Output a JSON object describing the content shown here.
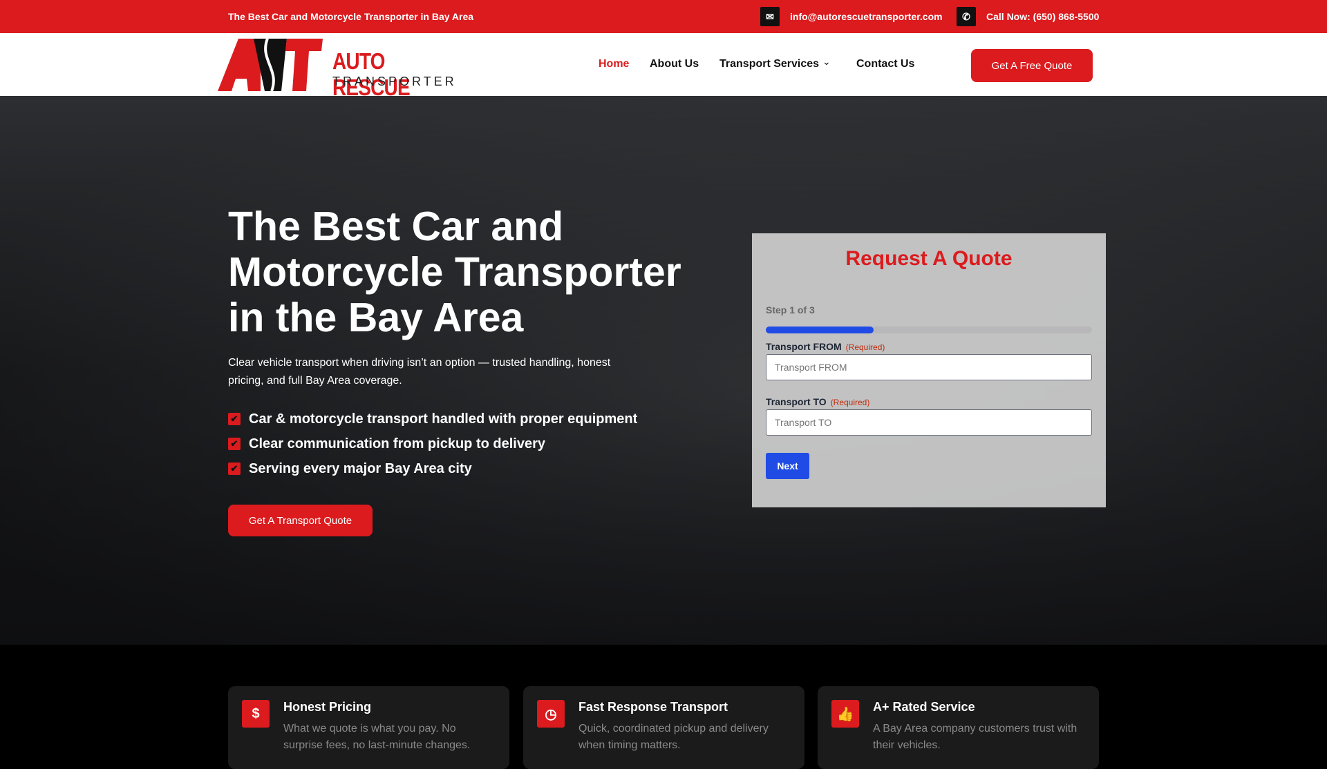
{
  "topbar": {
    "tagline": "The Best Car and Motorcycle Transporter in Bay Area",
    "email": "info@autorescuetransporter.com",
    "phone": "Call Now: (650) 868-5500"
  },
  "logo": {
    "line1": "AUTO RESCUE",
    "line2": "TRANSPORTER",
    "mark": "ART"
  },
  "nav": {
    "items": [
      "Home",
      "About Us",
      "Transport Services",
      "Contact Us"
    ],
    "cta": "Get A Free Quote"
  },
  "hero": {
    "title": "The Best Car and Motorcycle Transporter in the Bay Area",
    "lead": "Clear vehicle transport when driving isn’t an option — trusted handling, honest pricing, and full Bay Area coverage.",
    "checks": [
      "Car & motorcycle transport handled with proper equipment",
      "Clear communication from pickup to delivery",
      "Serving every major Bay Area city"
    ],
    "cta": "Get A Transport Quote"
  },
  "form": {
    "title": "Request A Quote",
    "step": "Step 1 of 3",
    "progress_percent": 33,
    "from_label": "Transport FROM",
    "to_label": "Transport TO",
    "required": "(Required)",
    "from_placeholder": "Transport FROM",
    "to_placeholder": "Transport TO",
    "next": "Next"
  },
  "features": [
    {
      "title": "Honest Pricing",
      "text": "What we quote is what you pay. No surprise fees, no last-minute changes.",
      "icon": "$"
    },
    {
      "title": "Fast Response Transport",
      "text": "Quick, coordinated pickup and delivery when timing matters.",
      "icon": "clock"
    },
    {
      "title": "A+ Rated Service",
      "text": "A Bay Area company customers trust with their vehicles.",
      "icon": "thumbs-up"
    }
  ],
  "colors": {
    "brand": "#db1b1e",
    "accent": "#204ce5"
  }
}
